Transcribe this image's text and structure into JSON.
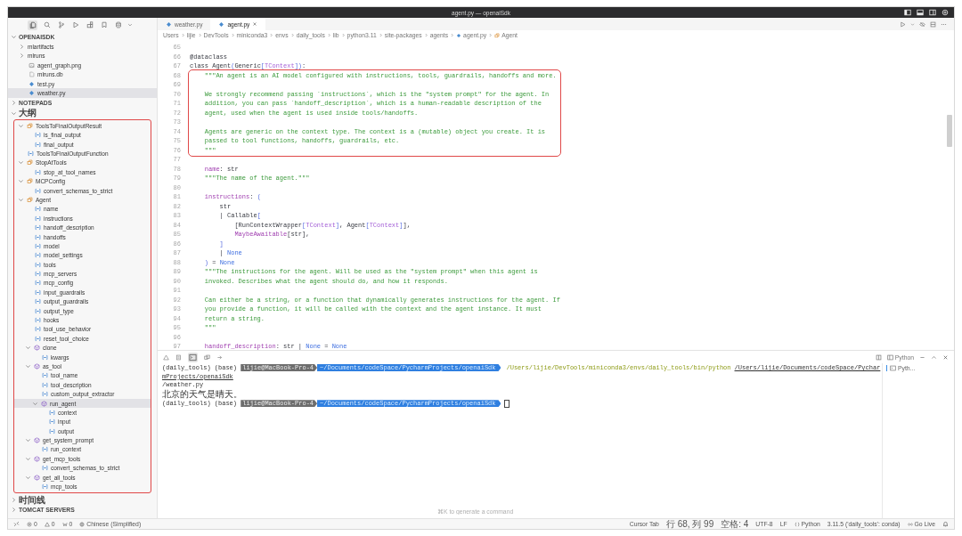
{
  "window": {
    "title": "agent.py — openaiSdk"
  },
  "activity_bar": [
    {
      "kind": "files",
      "selected": true
    },
    {
      "kind": "search",
      "selected": false
    },
    {
      "kind": "branch",
      "selected": false
    },
    {
      "kind": "run",
      "selected": false
    },
    {
      "kind": "extensions",
      "selected": false
    },
    {
      "kind": "bookmark",
      "selected": false
    },
    {
      "kind": "database",
      "selected": false
    }
  ],
  "sidebar": {
    "sections": [
      {
        "title": "OPENAISDK",
        "expanded": true,
        "items": [
          {
            "label": "mlartifacts",
            "kind": "folder",
            "expanded": false,
            "selected": false
          },
          {
            "label": "mlruns",
            "kind": "folder",
            "expanded": false,
            "selected": false
          },
          {
            "label": "agent_graph.png",
            "kind": "image",
            "selected": false
          },
          {
            "label": "mlruns.db",
            "kind": "data",
            "selected": false
          },
          {
            "label": "test.py",
            "kind": "python",
            "selected": false
          },
          {
            "label": "weather.py",
            "kind": "python",
            "selected": true
          }
        ]
      },
      {
        "title": "NOTEPADS",
        "expanded": false
      },
      {
        "title": "大纲",
        "expanded": true,
        "annotated": true,
        "items": [
          {
            "label": "ToolsToFinalOutputResult",
            "kind": "class",
            "expanded": true,
            "selected": false,
            "children": [
              {
                "label": "is_final_output",
                "kind": "field",
                "selected": false
              },
              {
                "label": "final_output",
                "kind": "field",
                "selected": false
              }
            ]
          },
          {
            "label": "ToolsToFinalOutputFunction",
            "kind": "field",
            "selected": false
          },
          {
            "label": "StopAtTools",
            "kind": "class",
            "expanded": true,
            "selected": false,
            "children": [
              {
                "label": "stop_at_tool_names",
                "kind": "field",
                "selected": false
              }
            ]
          },
          {
            "label": "MCPConfig",
            "kind": "class",
            "expanded": true,
            "selected": false,
            "children": [
              {
                "label": "convert_schemas_to_strict",
                "kind": "field",
                "selected": false
              }
            ]
          },
          {
            "label": "Agent",
            "kind": "class",
            "expanded": true,
            "selected": false,
            "children": [
              {
                "label": "name",
                "kind": "field",
                "selected": false
              },
              {
                "label": "instructions",
                "kind": "field",
                "selected": false
              },
              {
                "label": "handoff_description",
                "kind": "field",
                "selected": false
              },
              {
                "label": "handoffs",
                "kind": "field",
                "selected": false
              },
              {
                "label": "model",
                "kind": "field",
                "selected": false
              },
              {
                "label": "model_settings",
                "kind": "field",
                "selected": false
              },
              {
                "label": "tools",
                "kind": "field",
                "selected": false
              },
              {
                "label": "mcp_servers",
                "kind": "field",
                "selected": false
              },
              {
                "label": "mcp_config",
                "kind": "field",
                "selected": false
              },
              {
                "label": "input_guardrails",
                "kind": "field",
                "selected": false
              },
              {
                "label": "output_guardrails",
                "kind": "field",
                "selected": false
              },
              {
                "label": "output_type",
                "kind": "field",
                "selected": false
              },
              {
                "label": "hooks",
                "kind": "field",
                "selected": false
              },
              {
                "label": "tool_use_behavior",
                "kind": "field",
                "selected": false
              },
              {
                "label": "reset_tool_choice",
                "kind": "field",
                "selected": false
              },
              {
                "label": "clone",
                "kind": "method",
                "expanded": true,
                "selected": false,
                "children": [
                  {
                    "label": "kwargs",
                    "kind": "field",
                    "selected": false
                  }
                ]
              },
              {
                "label": "as_tool",
                "kind": "method",
                "expanded": true,
                "selected": false,
                "children": [
                  {
                    "label": "tool_name",
                    "kind": "field",
                    "selected": false
                  },
                  {
                    "label": "tool_description",
                    "kind": "field",
                    "selected": false
                  },
                  {
                    "label": "custom_output_extractor",
                    "kind": "field",
                    "selected": false
                  },
                  {
                    "label": "run_agent",
                    "kind": "method",
                    "expanded": true,
                    "selected": true,
                    "children": [
                      {
                        "label": "context",
                        "kind": "field",
                        "selected": false
                      },
                      {
                        "label": "input",
                        "kind": "field",
                        "selected": false
                      },
                      {
                        "label": "output",
                        "kind": "field",
                        "selected": false
                      }
                    ]
                  }
                ]
              },
              {
                "label": "get_system_prompt",
                "kind": "method",
                "expanded": true,
                "selected": false,
                "children": [
                  {
                    "label": "run_context",
                    "kind": "field",
                    "selected": false
                  }
                ]
              },
              {
                "label": "get_mcp_tools",
                "kind": "method",
                "expanded": true,
                "selected": false,
                "children": [
                  {
                    "label": "convert_schemas_to_strict",
                    "kind": "field",
                    "selected": false
                  }
                ]
              },
              {
                "label": "get_all_tools",
                "kind": "method",
                "expanded": true,
                "selected": false,
                "children": [
                  {
                    "label": "mcp_tools",
                    "kind": "field",
                    "selected": false
                  }
                ]
              }
            ]
          }
        ]
      },
      {
        "title": "时间线",
        "expanded": false
      },
      {
        "title": "TOMCAT SERVERS",
        "expanded": false
      }
    ]
  },
  "editor": {
    "tabs": [
      {
        "label": "weather.py",
        "selected": false
      },
      {
        "label": "agent.py",
        "selected": true
      }
    ],
    "breadcrumb": [
      {
        "label": "Users",
        "kind": "folder"
      },
      {
        "label": "lijie",
        "kind": "folder"
      },
      {
        "label": "DevTools",
        "kind": "folder"
      },
      {
        "label": "miniconda3",
        "kind": "folder"
      },
      {
        "label": "envs",
        "kind": "folder"
      },
      {
        "label": "daily_tools",
        "kind": "folder"
      },
      {
        "label": "lib",
        "kind": "folder"
      },
      {
        "label": "python3.11",
        "kind": "folder"
      },
      {
        "label": "site-packages",
        "kind": "folder"
      },
      {
        "label": "agents",
        "kind": "folder"
      },
      {
        "label": "agent.py",
        "kind": "python"
      },
      {
        "label": "Agent",
        "kind": "class"
      }
    ],
    "blocks": [
      {
        "lines": [
          {
            "number": "65"
          },
          {
            "number": "66",
            "tokens": [
              {
                "kind": "plain",
                "text": "@dataclass"
              }
            ]
          },
          {
            "number": "67",
            "tokens": [
              {
                "kind": "plain",
                "text": "class Agent"
              },
              {
                "kind": "bracket",
                "text": "("
              },
              {
                "kind": "plain",
                "text": "Generic"
              },
              {
                "kind": "bracket",
                "text": "["
              },
              {
                "kind": "type",
                "text": "TContext"
              },
              {
                "kind": "bracket",
                "text": "])"
              },
              {
                "kind": "plain",
                "text": ":"
              }
            ]
          }
        ]
      },
      {
        "annotated": true,
        "lines": [
          {
            "number": "68",
            "tokens": [
              {
                "kind": "doc",
                "text": "    \"\"\"An agent is an AI model configured with instructions, tools, guardrails, handoffs and more."
              }
            ]
          },
          {
            "number": "69"
          },
          {
            "number": "70",
            "tokens": [
              {
                "kind": "doc",
                "text": "    We strongly recommend passing `instructions`, which is the \"system prompt\" for the agent. In"
              }
            ]
          },
          {
            "number": "71",
            "tokens": [
              {
                "kind": "doc",
                "text": "    addition, you can pass `handoff_description`, which is a human-readable description of the"
              }
            ]
          },
          {
            "number": "72",
            "tokens": [
              {
                "kind": "doc",
                "text": "    agent, used when the agent is used inside tools/handoffs."
              }
            ]
          },
          {
            "number": "73"
          },
          {
            "number": "74",
            "tokens": [
              {
                "kind": "doc",
                "text": "    Agents are generic on the context type. The context is a (mutable) object you create. It is"
              }
            ]
          },
          {
            "number": "75",
            "tokens": [
              {
                "kind": "doc",
                "text": "    passed to tool functions, handoffs, guardrails, etc."
              }
            ]
          },
          {
            "number": "76",
            "tokens": [
              {
                "kind": "doc",
                "text": "    \"\"\""
              }
            ]
          }
        ]
      },
      {
        "lines": [
          {
            "number": "77"
          },
          {
            "number": "78",
            "tokens": [
              {
                "kind": "attr",
                "text": "    name"
              },
              {
                "kind": "plain",
                "text": ": str"
              }
            ]
          },
          {
            "number": "79",
            "tokens": [
              {
                "kind": "doc",
                "text": "    \"\"\"The name of the agent.\"\"\""
              }
            ]
          },
          {
            "number": "80"
          },
          {
            "number": "81",
            "tokens": [
              {
                "kind": "attr",
                "text": "    instructions"
              },
              {
                "kind": "plain",
                "text": ": "
              },
              {
                "kind": "bracket",
                "text": "("
              }
            ]
          },
          {
            "number": "82",
            "tokens": [
              {
                "kind": "plain",
                "text": "        str"
              }
            ]
          },
          {
            "number": "83",
            "tokens": [
              {
                "kind": "plain",
                "text": "        | Callable"
              },
              {
                "kind": "bracket",
                "text": "["
              }
            ]
          },
          {
            "number": "84",
            "tokens": [
              {
                "kind": "plain",
                "text": "            [RunContextWrapper"
              },
              {
                "kind": "bracket",
                "text": "["
              },
              {
                "kind": "type",
                "text": "TContext"
              },
              {
                "kind": "bracket",
                "text": "]"
              },
              {
                "kind": "plain",
                "text": ", Agent"
              },
              {
                "kind": "bracket",
                "text": "["
              },
              {
                "kind": "type",
                "text": "TContext"
              },
              {
                "kind": "bracket",
                "text": "]"
              },
              {
                "kind": "plain",
                "text": "],"
              }
            ]
          },
          {
            "number": "85",
            "tokens": [
              {
                "kind": "attr",
                "text": "            MaybeAwaitable"
              },
              {
                "kind": "plain",
                "text": "[str],"
              }
            ]
          },
          {
            "number": "86",
            "tokens": [
              {
                "kind": "bracket",
                "text": "        ]"
              }
            ]
          },
          {
            "number": "87",
            "tokens": [
              {
                "kind": "plain",
                "text": "        | "
              },
              {
                "kind": "const",
                "text": "None"
              }
            ]
          },
          {
            "number": "88",
            "tokens": [
              {
                "kind": "bracket",
                "text": "    )"
              },
              {
                "kind": "plain",
                "text": " = "
              },
              {
                "kind": "const",
                "text": "None"
              }
            ]
          },
          {
            "number": "89",
            "tokens": [
              {
                "kind": "doc",
                "text": "    \"\"\"The instructions for the agent. Will be used as the \"system prompt\" when this agent is"
              }
            ]
          },
          {
            "number": "90",
            "tokens": [
              {
                "kind": "doc",
                "text": "    invoked. Describes what the agent should do, and how it responds."
              }
            ]
          },
          {
            "number": "91"
          },
          {
            "number": "92",
            "tokens": [
              {
                "kind": "doc",
                "text": "    Can either be a string, or a function that dynamically generates instructions for the agent. If"
              }
            ]
          },
          {
            "number": "93",
            "tokens": [
              {
                "kind": "doc",
                "text": "    you provide a function, it will be called with the context and the agent instance. It must"
              }
            ]
          },
          {
            "number": "94",
            "tokens": [
              {
                "kind": "doc",
                "text": "    return a string."
              }
            ]
          },
          {
            "number": "95",
            "tokens": [
              {
                "kind": "doc",
                "text": "    \"\"\""
              }
            ]
          },
          {
            "number": "96"
          },
          {
            "number": "97",
            "tokens": [
              {
                "kind": "attr",
                "text": "    handoff_description"
              },
              {
                "kind": "plain",
                "text": ": str | "
              },
              {
                "kind": "const",
                "text": "None"
              },
              {
                "kind": "plain",
                "text": " = "
              },
              {
                "kind": "const",
                "text": "None"
              }
            ]
          }
        ]
      }
    ]
  },
  "terminal": {
    "profile": "Python",
    "tabs": [
      {
        "label": "Pyth...",
        "selected": true
      }
    ],
    "lines": [
      {
        "cursor": false,
        "segments": [
          {
            "kind": "plain",
            "text": "(daily_tools) (base) "
          },
          {
            "kind": "host",
            "text": "lijie@MacBook-Pro-4"
          },
          {
            "kind": "path",
            "text": "~/Documents/codeSpace/PycharmProjects/openaiSdk"
          },
          {
            "kind": "command",
            "text": "/Users/lijie/DevTools/miniconda3/envs/daily_tools/bin/python"
          },
          {
            "kind": "arg",
            "text": "/Users/lijie/Documents/codeSpace/PycharmProjects/openaiSdk"
          }
        ]
      },
      {
        "cursor": false,
        "segments": [
          {
            "kind": "plain",
            "text": "/weather.py"
          }
        ]
      },
      {
        "cursor": false,
        "segments": [
          {
            "kind": "plain",
            "text": "北京的天气是晴天。"
          }
        ]
      },
      {
        "cursor": true,
        "segments": [
          {
            "kind": "plain",
            "text": "(daily_tools) (base) "
          },
          {
            "kind": "host",
            "text": "lijie@MacBook-Pro-4"
          },
          {
            "kind": "path",
            "text": "~/Documents/codeSpace/PycharmProjects/openaiSdk"
          }
        ]
      }
    ],
    "placeholder": "⌘K to generate a command"
  },
  "status_bar": {
    "left": [
      {
        "kind": "errors",
        "text": "0"
      },
      {
        "kind": "warnings",
        "text": "0"
      },
      {
        "kind": "ports",
        "text": "0"
      },
      {
        "kind": "language",
        "text": "Chinese (Simplified)"
      }
    ],
    "right": [
      {
        "kind": "text",
        "text": "Cursor Tab"
      },
      {
        "kind": "text",
        "text": "行 68, 列 99"
      },
      {
        "kind": "text",
        "text": "空格: 4"
      },
      {
        "kind": "text",
        "text": "UTF-8"
      },
      {
        "kind": "text",
        "text": "LF"
      },
      {
        "kind": "mode",
        "text": "Python"
      },
      {
        "kind": "text",
        "text": "3.11.5 ('daily_tools': conda)"
      },
      {
        "kind": "live",
        "text": "Go Live"
      },
      {
        "kind": "bell"
      }
    ]
  }
}
